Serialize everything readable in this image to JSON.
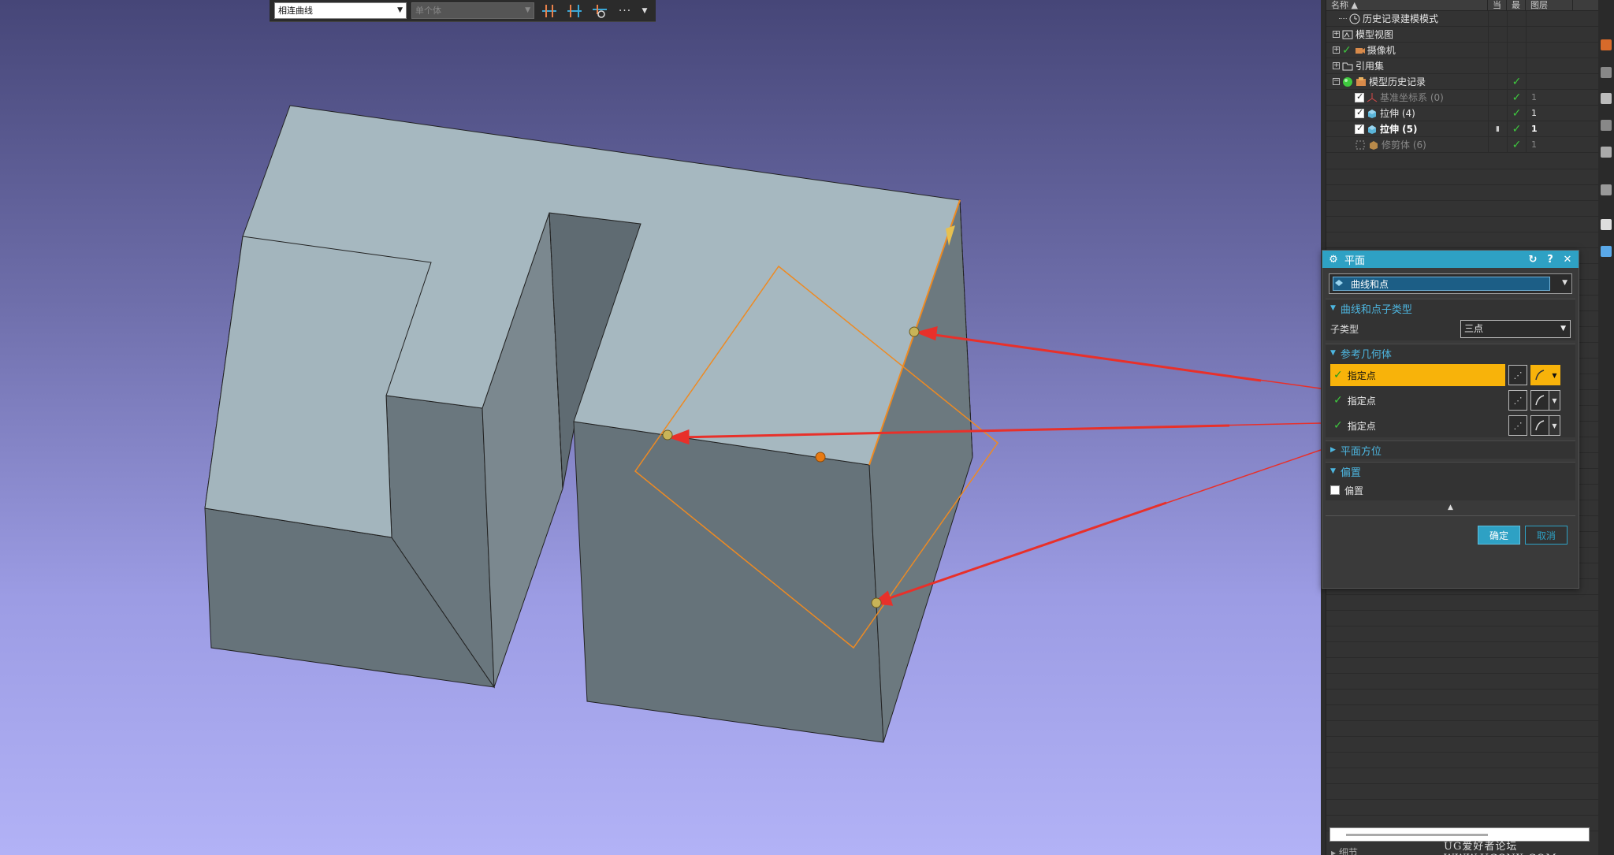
{
  "toolbar": {
    "curve_rule": "相连曲线",
    "body_filter": "单个体",
    "more": "···"
  },
  "navigator": {
    "columns": {
      "name": "名称",
      "current": "当",
      "latest": "最",
      "layer": "图层"
    },
    "items": [
      {
        "label": "历史记录建模模式",
        "layer": ""
      },
      {
        "label": "模型视图",
        "layer": ""
      },
      {
        "label": "摄像机",
        "layer": ""
      },
      {
        "label": "引用集",
        "layer": ""
      },
      {
        "label": "模型历史记录",
        "layer": ""
      },
      {
        "label": "基准坐标系 (0)",
        "layer": "1"
      },
      {
        "label": "拉伸 (4)",
        "layer": "1"
      },
      {
        "label": "拉伸 (5)",
        "layer": "1"
      },
      {
        "label": "修剪体 (6)",
        "layer": "1"
      }
    ],
    "bottom_label": "细节"
  },
  "dialog": {
    "title": "平面",
    "type_value": "曲线和点",
    "sections": {
      "subtype": "曲线和点子类型",
      "reference": "参考几何体",
      "orientation": "平面方位",
      "offset": "偏置"
    },
    "subtype_label": "子类型",
    "subtype_value": "三点",
    "points": [
      {
        "label": "指定点",
        "active": true
      },
      {
        "label": "指定点",
        "active": false
      },
      {
        "label": "指定点",
        "active": false
      }
    ],
    "offset_checkbox": "偏置",
    "ok": "确定",
    "cancel": "取消"
  },
  "watermark": "UG爱好者论坛 WWW.UGSNX.COM",
  "colors": {
    "accent": "#2ea1c4",
    "highlight": "#f8b30a",
    "check": "#3ec83e",
    "arrow": "#e8302a",
    "plane_outline": "#ee8a22",
    "model_top": "#a6b8c0",
    "model_side": "#66737a"
  }
}
